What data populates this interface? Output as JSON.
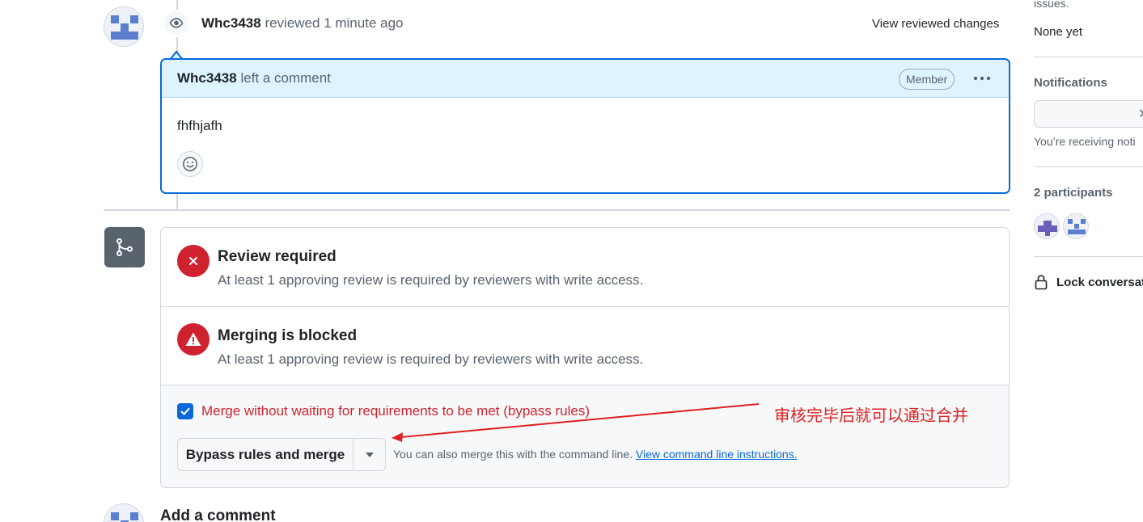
{
  "timeline": {
    "review": {
      "author": "Whc3438",
      "action": "reviewed 1 minute ago",
      "view_changes_label": "View reviewed changes"
    },
    "comment": {
      "author": "Whc3438",
      "action": "left a comment",
      "role_badge": "Member",
      "body": "fhfhjafh"
    }
  },
  "merge_box": {
    "review_required": {
      "title": "Review required",
      "description": "At least 1 approving review is required by reviewers with write access."
    },
    "merging_blocked": {
      "title": "Merging is blocked",
      "description": "At least 1 approving review is required by reviewers with write access."
    },
    "bypass": {
      "checked": true,
      "label": "Merge without waiting for requirements to be met (bypass rules)"
    },
    "merge_button_label": "Bypass rules and merge",
    "cli_text": "You can also merge this with the command line.",
    "cli_link": "View command line instructions."
  },
  "annotation": {
    "text": "审核完毕后就可以通过合并",
    "color": "#e02020"
  },
  "add_comment": {
    "title": "Add a comment"
  },
  "sidebar": {
    "issues_text": "issues.",
    "issues_value": "None yet",
    "notifications_title": "Notifications",
    "notifications_note": "You’re receiving noti",
    "participants_title": "2 participants",
    "lock_label": "Lock conversatio"
  },
  "colors": {
    "accent": "#0969da",
    "danger": "#cf222e",
    "comment_header_bg": "#ddf4ff"
  }
}
